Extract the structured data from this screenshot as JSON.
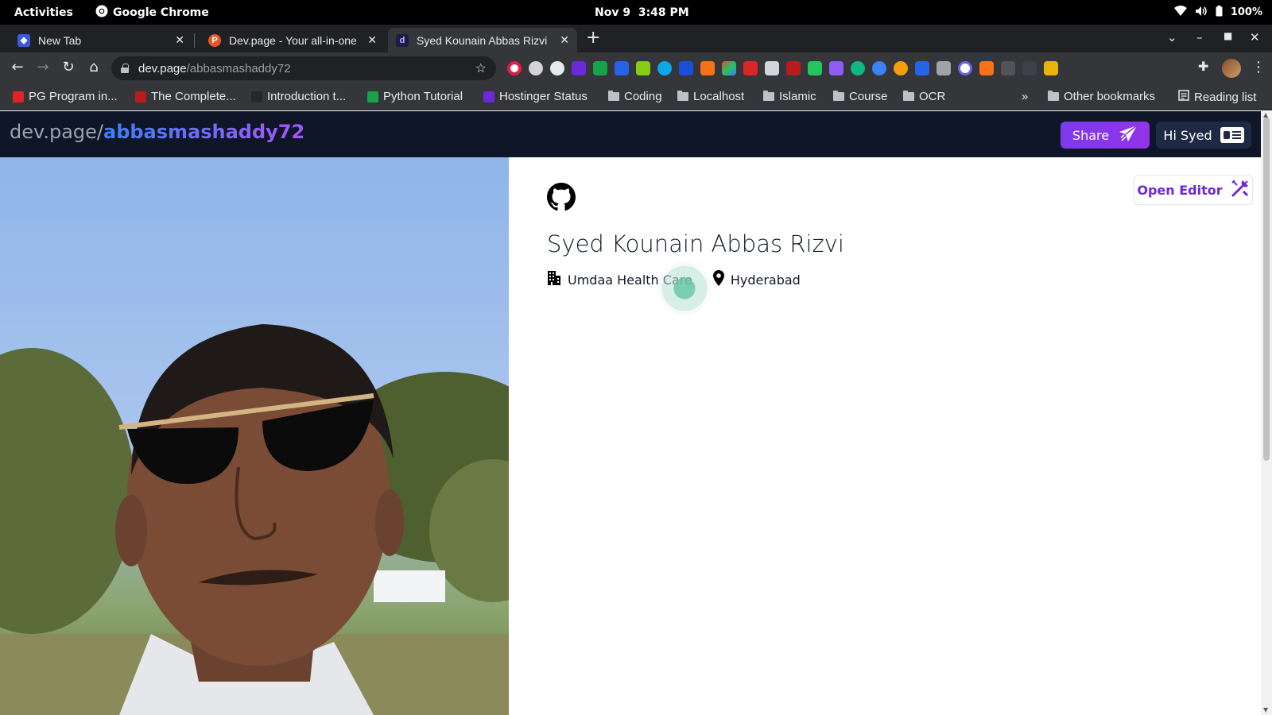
{
  "system": {
    "activities": "Activities",
    "app_name": "Google Chrome",
    "date": "Nov 9",
    "time": "3:48 PM",
    "battery": "100%"
  },
  "tabs": [
    {
      "title": "New Tab",
      "active": false
    },
    {
      "title": "Dev.page - Your all-in-one",
      "active": false
    },
    {
      "title": "Syed Kounain Abbas Rizvi",
      "active": true
    }
  ],
  "address_bar": {
    "host": "dev.page",
    "path": "/abbasmashaddy72"
  },
  "bookmarks": [
    {
      "label": "PG Program in...",
      "type": "site"
    },
    {
      "label": "The Complete...",
      "type": "site"
    },
    {
      "label": "Introduction t...",
      "type": "site"
    },
    {
      "label": "Python Tutorial",
      "type": "site"
    },
    {
      "label": "Hostinger Status",
      "type": "site"
    },
    {
      "label": "Coding",
      "type": "folder"
    },
    {
      "label": "Localhost",
      "type": "folder"
    },
    {
      "label": "Islamic",
      "type": "folder"
    },
    {
      "label": "Course",
      "type": "folder"
    },
    {
      "label": "OCR",
      "type": "folder"
    }
  ],
  "bookmarks_overflow": "»",
  "other_bookmarks": "Other bookmarks",
  "reading_list": "Reading list",
  "site": {
    "brand_base": "dev.page/",
    "brand_user": "abbasmashaddy72",
    "share_label": "Share",
    "greeting": "Hi Syed",
    "open_editor": "Open Editor"
  },
  "profile": {
    "name": "Syed Kounain Abbas Rizvi",
    "company": "Umdaa Health Care",
    "location": "Hyderabad"
  },
  "colors": {
    "header_bg": "#0f1628",
    "accent_purple": "#7c3aed",
    "brand_gradient_start": "#3b82f6",
    "brand_gradient_end": "#a855f7"
  }
}
